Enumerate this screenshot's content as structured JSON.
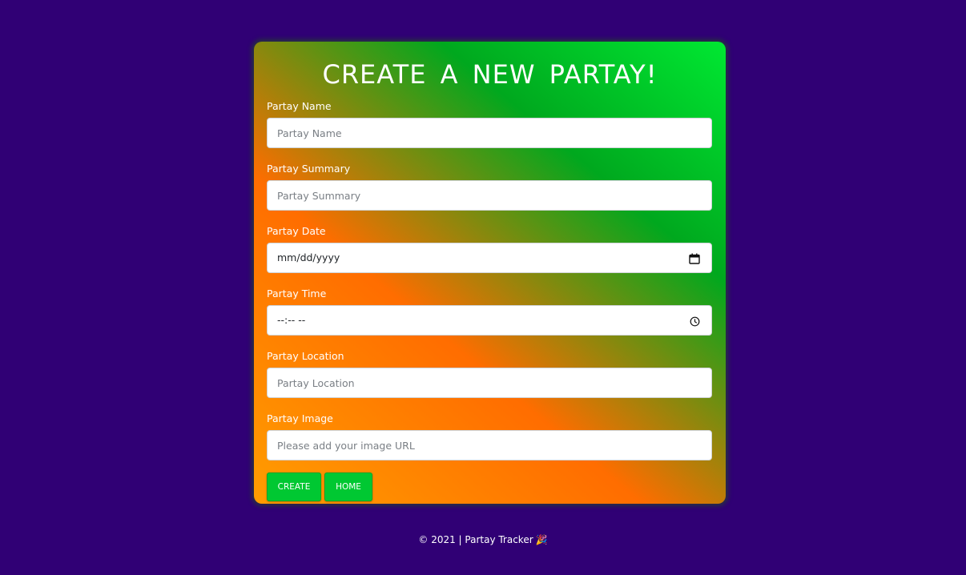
{
  "form": {
    "title": "CREATE A NEW PARTAY!",
    "fields": [
      {
        "label": "Partay Name",
        "placeholder": "Partay Name"
      },
      {
        "label": "Partay Summary",
        "placeholder": "Partay Summary"
      },
      {
        "label": "Partay Date",
        "value": "mm/dd/yyyy",
        "icon": "calendar-icon"
      },
      {
        "label": "Partay Time",
        "value": "--:-- --",
        "icon": "clock-icon"
      },
      {
        "label": "Partay Location",
        "placeholder": "Partay Location"
      },
      {
        "label": "Partay Image",
        "placeholder": "Please add your image URL"
      }
    ],
    "buttons": {
      "create": "CREATE",
      "home": "HOME"
    }
  },
  "footer": {
    "text": "© 2021 | Partay Tracker",
    "emoji": "🎉"
  },
  "colors": {
    "background": "#300075",
    "button": "#00c832",
    "gradient": [
      "#00e832",
      "#00a81e",
      "#ff6d00",
      "#ff9d00"
    ]
  }
}
